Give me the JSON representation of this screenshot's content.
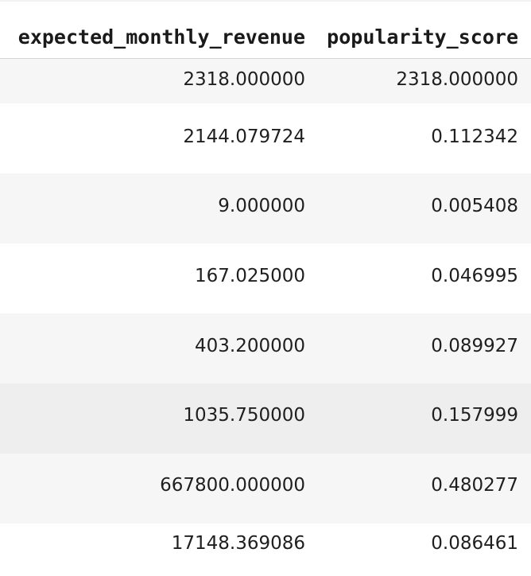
{
  "table": {
    "columns": [
      "expected_monthly_revenue",
      "popularity_score"
    ],
    "rows": [
      [
        "2318.000000",
        "2318.000000"
      ],
      [
        "2144.079724",
        "0.112342"
      ],
      [
        "9.000000",
        "0.005408"
      ],
      [
        "167.025000",
        "0.046995"
      ],
      [
        "403.200000",
        "0.089927"
      ],
      [
        "1035.750000",
        "0.157999"
      ],
      [
        "667800.000000",
        "0.480277"
      ],
      [
        "17148.369086",
        "0.086461"
      ]
    ]
  },
  "colors": {
    "row_striped": "#f6f6f6",
    "row_plain": "#ffffff",
    "row_hover": "#eeeeee",
    "header_divider": "#d6d6d6"
  }
}
